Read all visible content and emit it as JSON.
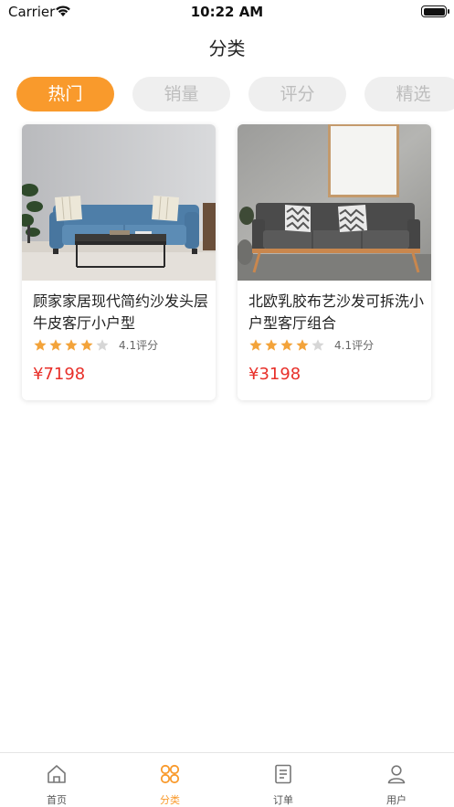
{
  "status_bar": {
    "carrier": "Carrier",
    "time": "10:22 AM"
  },
  "nav": {
    "title": "分类"
  },
  "tabs": [
    {
      "label": "热门",
      "active": true
    },
    {
      "label": "销量",
      "active": false
    },
    {
      "label": "评分",
      "active": false
    },
    {
      "label": "精选",
      "active": false
    }
  ],
  "products": [
    {
      "title": "顾家家居现代简约沙发头层牛皮客厅小户型",
      "rating": 4.1,
      "rating_text": "4.1评分",
      "price": "¥7198"
    },
    {
      "title": "北欧乳胶布艺沙发可拆洗小户型客厅组合",
      "rating": 4.1,
      "rating_text": "4.1评分",
      "price": "¥3198"
    }
  ],
  "tabbar": [
    {
      "label": "首页",
      "icon": "home-icon",
      "active": false
    },
    {
      "label": "分类",
      "icon": "category-icon",
      "active": true
    },
    {
      "label": "订单",
      "icon": "order-icon",
      "active": false
    },
    {
      "label": "用户",
      "icon": "user-icon",
      "active": false
    }
  ],
  "colors": {
    "accent": "#f99a2c",
    "price": "#e8302a",
    "star_on": "#f3a33a",
    "star_off": "#d6d6d6"
  }
}
